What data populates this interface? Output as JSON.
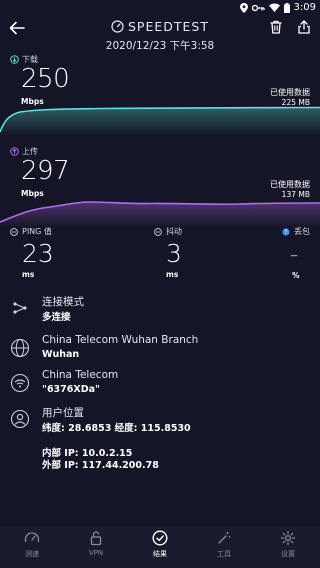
{
  "status_bar": {
    "time": "3:09"
  },
  "header": {
    "title": "SPEEDTEST",
    "date": "2020/12/23 下午3:58"
  },
  "download": {
    "label": "下载",
    "value": "250",
    "unit": "Mbps",
    "data_used_label": "已使用数据",
    "data_used_value": "225 MB",
    "accent": "#5fe3d7"
  },
  "upload": {
    "label": "上传",
    "value": "297",
    "unit": "Mbps",
    "data_used_label": "已使用数据",
    "data_used_value": "137 MB",
    "accent": "#b76cf2"
  },
  "stats": {
    "ping": {
      "label": "PING 值",
      "value": "23",
      "unit": "ms"
    },
    "jitter": {
      "label": "抖动",
      "value": "3",
      "unit": "ms"
    },
    "loss": {
      "label": "丢包",
      "value": "–",
      "unit": "%"
    }
  },
  "info": {
    "connection_mode_label": "连接模式",
    "connection_mode_value": "多连接",
    "server_name": "China Telecom Wuhan Branch",
    "server_city": "Wuhan",
    "provider": "China Telecom",
    "wifi_name": "\"6376XDa\"",
    "user_location_label": "用户位置",
    "coords": "纬度: 28.6853 经度: 115.8530",
    "internal_ip": "内部 IP: 10.0.2.15",
    "external_ip": "外部 IP: 117.44.200.78"
  },
  "nav": {
    "items": [
      {
        "label": "测速"
      },
      {
        "label": "VPN"
      },
      {
        "label": "结果"
      },
      {
        "label": "工具"
      },
      {
        "label": "设置"
      }
    ]
  },
  "colors": {
    "background": "#141526",
    "download": "#5fe3d7",
    "upload": "#b76cf2",
    "info_icon": "#3d8df5"
  },
  "icons": [
    "back-arrow-icon",
    "speedometer-icon",
    "trash-icon",
    "share-icon",
    "globe-icon",
    "wifi-icon",
    "user-icon"
  ]
}
